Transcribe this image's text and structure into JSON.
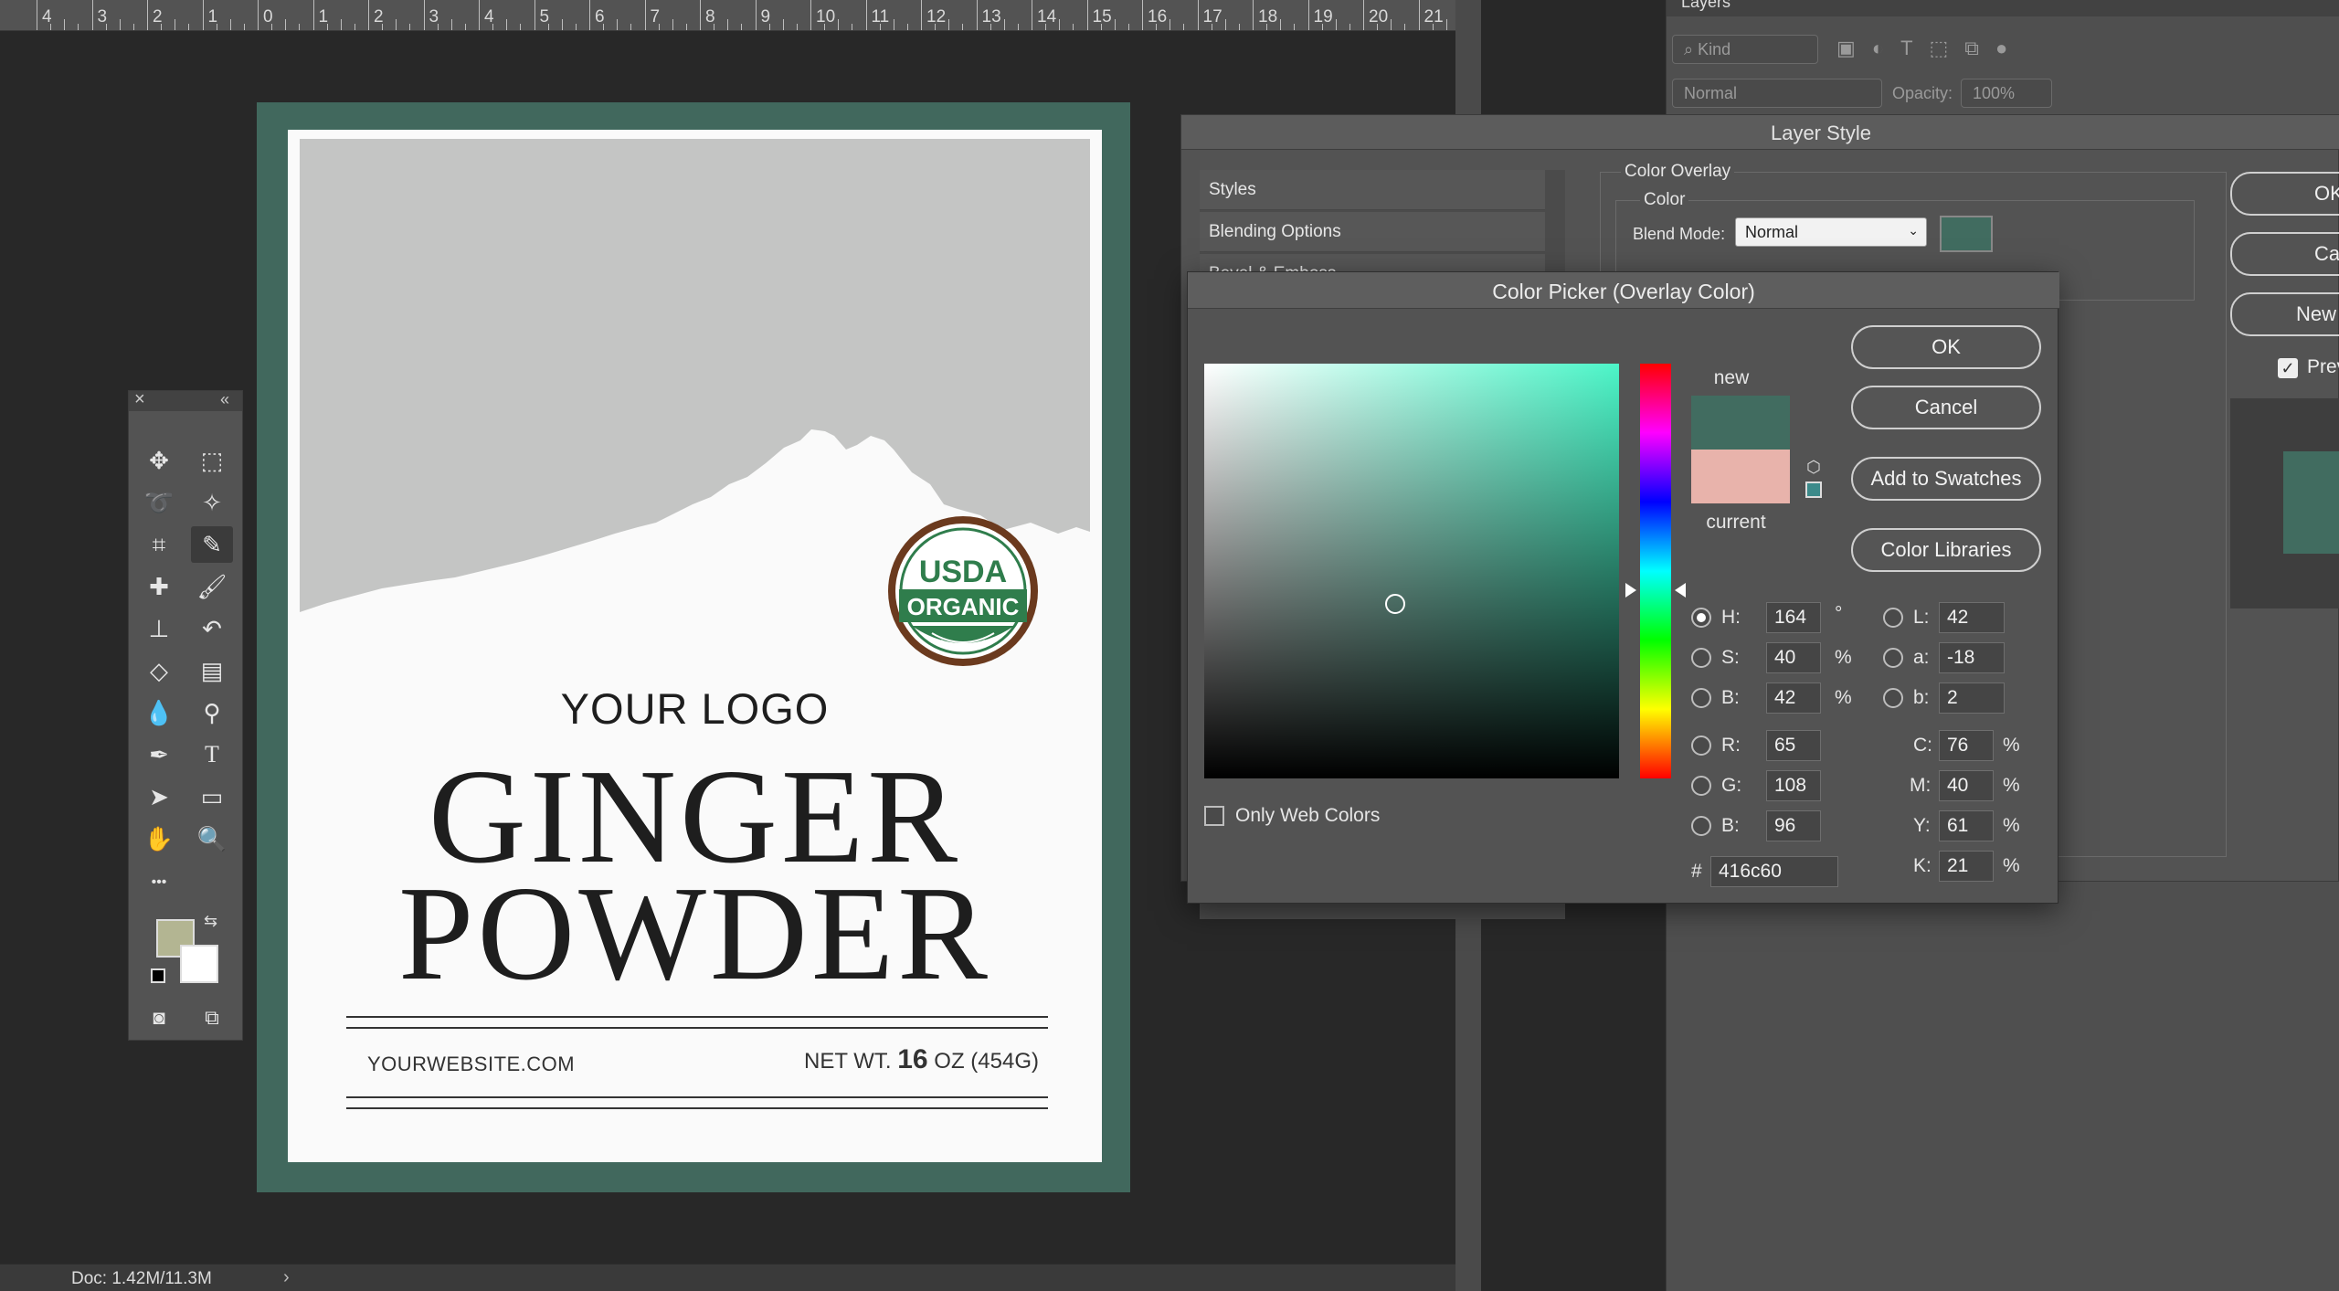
{
  "ruler": {
    "numbers": [
      "4",
      "3",
      "2",
      "1",
      "0",
      "1",
      "2",
      "3",
      "4",
      "5",
      "6",
      "7",
      "8",
      "9",
      "10",
      "11",
      "12",
      "13",
      "14",
      "15",
      "16",
      "17",
      "18",
      "19",
      "20",
      "21"
    ]
  },
  "status": {
    "doc": "Doc: 1.42M/11.3M",
    "arrow": "›"
  },
  "label": {
    "logo": "YOUR LOGO",
    "title_line1": "GINGER",
    "title_line2": "POWDER",
    "website": "YOURWEBSITE.COM",
    "netwt_prefix": "NET WT.",
    "netwt_number": "16",
    "netwt_suffix": "OZ (454G)",
    "badge_top": "USDA",
    "badge_bottom": "ORGANIC",
    "colors": {
      "border": "#41685d",
      "badge_ring": "#6b3a1e",
      "badge_green": "#2f7d4c"
    }
  },
  "tools": {
    "close": "×",
    "collapse": "«",
    "more": "•••"
  },
  "layers": {
    "tab": "Layers",
    "kind_filter": "Kind",
    "blend": "Normal",
    "opacity_label": "Opacity:",
    "opacity_value": "100%"
  },
  "layer_style": {
    "title": "Layer Style",
    "styles_row": "Styles",
    "blending_row": "Blending Options",
    "bevel_row": "Bevel & Emboss",
    "section_title": "Color Overlay",
    "subsection": "Color",
    "blend_mode_label": "Blend Mode:",
    "blend_mode_value": "Normal",
    "overlay_color": "#416c60",
    "buttons": {
      "ok": "OK",
      "cancel": "Cancel",
      "new_style": "New Style...",
      "preview": "Preview"
    }
  },
  "color_picker": {
    "title": "Color Picker (Overlay Color)",
    "new_label": "new",
    "current_label": "current",
    "new_color": "#416c60",
    "current_color": "#e8b3ab",
    "hue_color": "#4cf5c8",
    "buttons": {
      "ok": "OK",
      "cancel": "Cancel",
      "add_swatches": "Add to Swatches",
      "libraries": "Color Libraries"
    },
    "only_web_colors": "Only Web Colors",
    "hsb": {
      "h_label": "H:",
      "h": "164",
      "h_unit": "°",
      "s_label": "S:",
      "s": "40",
      "s_unit": "%",
      "b_label": "B:",
      "b": "42",
      "b_unit": "%"
    },
    "lab": {
      "l_label": "L:",
      "l": "42",
      "a_label": "a:",
      "a": "-18",
      "b_label": "b:",
      "b": "2"
    },
    "rgb": {
      "r_label": "R:",
      "r": "65",
      "g_label": "G:",
      "g": "108",
      "b_label": "B:",
      "b": "96"
    },
    "cmyk": {
      "c_label": "C:",
      "c": "76",
      "m_label": "M:",
      "m": "40",
      "y_label": "Y:",
      "y": "61",
      "k_label": "K:",
      "k": "21",
      "unit": "%"
    },
    "hex_label": "#",
    "hex": "416c60"
  }
}
